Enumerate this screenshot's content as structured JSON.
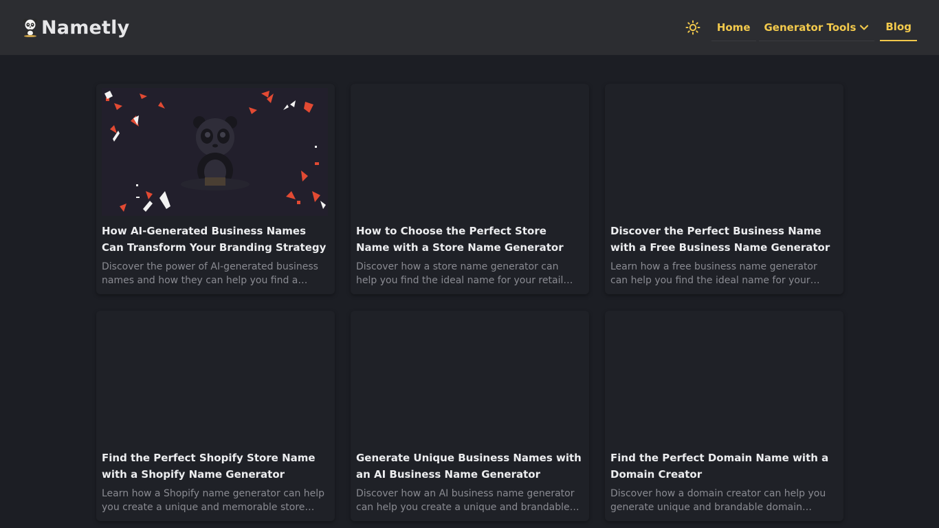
{
  "header": {
    "brand": "Nametly",
    "nav": {
      "home": "Home",
      "tools": "Generator Tools",
      "blog": "Blog"
    },
    "accent_color": "#f2c94c"
  },
  "icons": {
    "logo": "panda-logo-icon",
    "theme": "sun-icon",
    "dropdown": "chevron-down-icon"
  },
  "posts": [
    {
      "title": "How AI-Generated Business Names Can Transform Your Branding Strategy",
      "excerpt": "Discover the power of AI-generated business names and how they can help you find a unique and memorable brand name."
    },
    {
      "title": "How to Choose the Perfect Store Name with a Store Name Generator",
      "excerpt": "Discover how a store name generator can help you find the ideal name for your retail business."
    },
    {
      "title": "Discover the Perfect Business Name with a Free Business Name Generator",
      "excerpt": "Learn how a free business name generator can help you find the ideal name for your company."
    },
    {
      "title": "Find the Perfect Shopify Store Name with a Shopify Name Generator",
      "excerpt": "Learn how a Shopify name generator can help you create a unique and memorable store name."
    },
    {
      "title": "Generate Unique Business Names with an AI Business Name Generator",
      "excerpt": "Discover how an AI business name generator can help you create a unique and brandable name."
    },
    {
      "title": "Find the Perfect Domain Name with a Domain Creator",
      "excerpt": "Discover how a domain creator can help you generate unique and brandable domain names."
    }
  ]
}
